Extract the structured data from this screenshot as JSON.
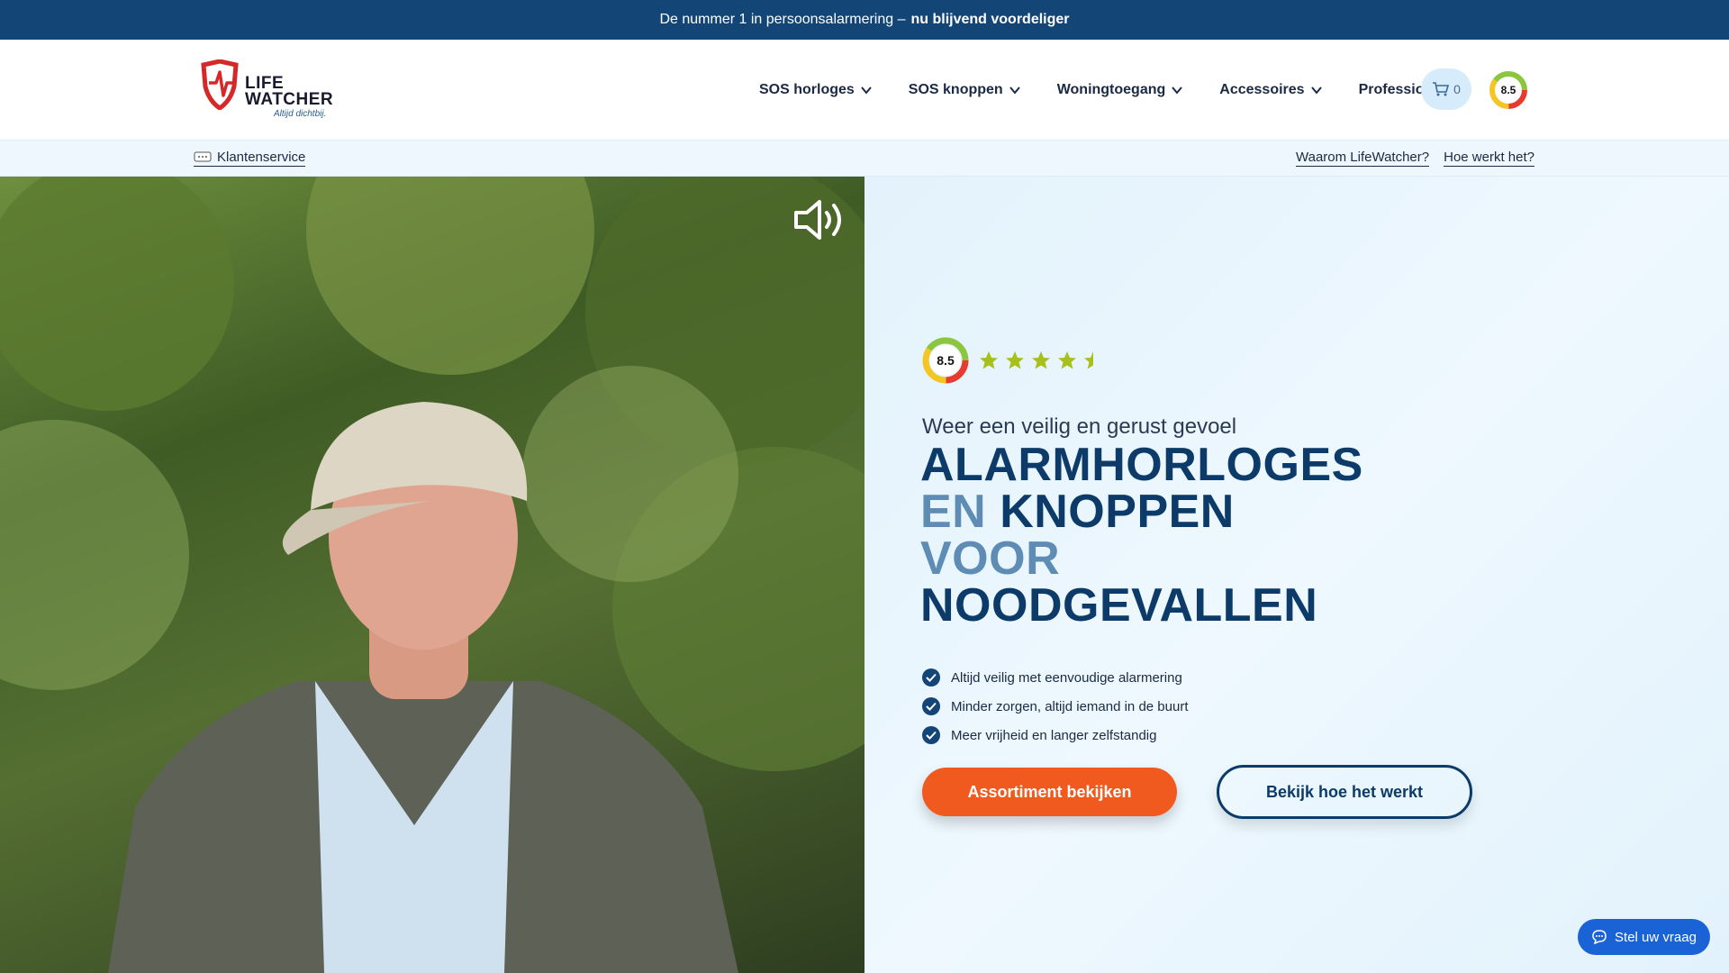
{
  "topbar": {
    "text": "De nummer 1 in persoonsalarmering –",
    "bold": "nu blijvend voordeliger"
  },
  "logo": {
    "line1": "LIFE",
    "line2": "WATCHER",
    "tagline": "Altijd dichtbij."
  },
  "nav": {
    "items": [
      {
        "label": "SOS horloges",
        "dropdown": true
      },
      {
        "label": "SOS knoppen",
        "dropdown": true
      },
      {
        "label": "Woningtoegang",
        "dropdown": true
      },
      {
        "label": "Accessoires",
        "dropdown": true
      },
      {
        "label": "Professionals",
        "dropdown": false
      }
    ],
    "cart_count": "0",
    "score": "8.5"
  },
  "subbar": {
    "customer_service": "Klantenservice",
    "links": [
      "Waarom LifeWatcher?",
      "Hoe werkt het?"
    ]
  },
  "hero": {
    "score": "8.5",
    "stars": 4.5,
    "tagline": "Weer een veilig en gerust gevoel",
    "title": {
      "line1": "ALARMHORLOGES",
      "line2_light": "EN",
      "line2_dark": "KNOPPEN",
      "line3_light": "VOOR",
      "line4": "NOODGEVALLEN"
    },
    "bullets": [
      "Altijd veilig met eenvoudige alarmering",
      "Minder zorgen, altijd iemand in de buurt",
      "Meer vrijheid en langer zelfstandig"
    ],
    "primary_button": "Assortiment bekijken",
    "secondary_button": "Bekijk hoe het werkt"
  },
  "chat": {
    "label": "Stel uw vraag"
  },
  "colors": {
    "navy": "#134677",
    "title": "#0c3a69",
    "light_title": "#5e8cb4",
    "orange": "#f05a1f",
    "chat_blue": "#1a63d6"
  }
}
